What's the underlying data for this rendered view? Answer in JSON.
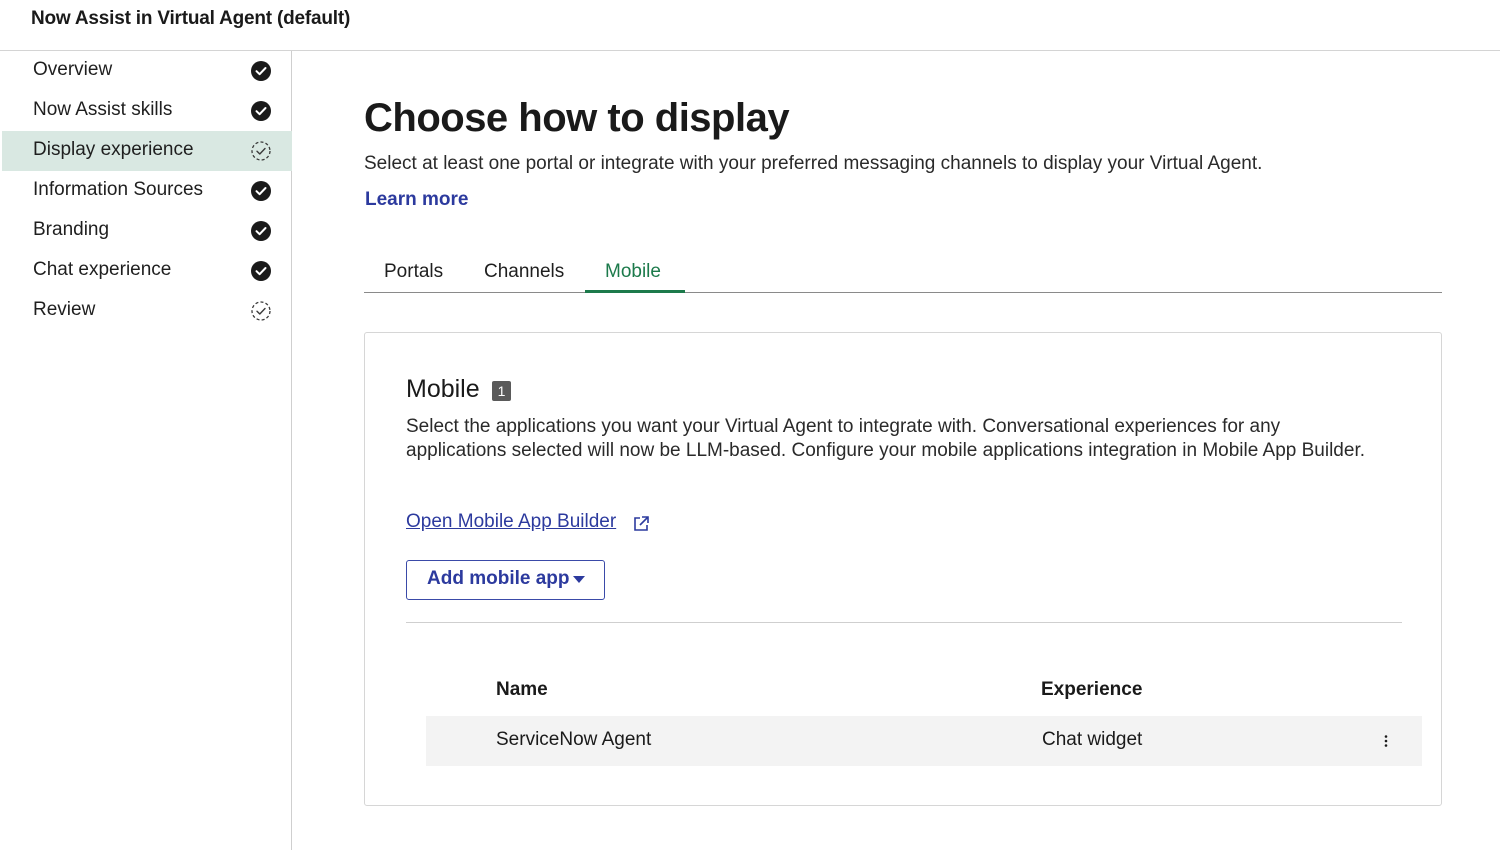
{
  "header": {
    "title": "Now Assist in Virtual Agent (default)"
  },
  "sidebar": {
    "items": [
      {
        "label": "Overview",
        "status": "complete"
      },
      {
        "label": "Now Assist skills",
        "status": "complete"
      },
      {
        "label": "Display experience",
        "status": "in-progress",
        "active": true
      },
      {
        "label": "Information Sources",
        "status": "complete"
      },
      {
        "label": "Branding",
        "status": "complete"
      },
      {
        "label": "Chat experience",
        "status": "complete"
      },
      {
        "label": "Review",
        "status": "in-progress"
      }
    ]
  },
  "main": {
    "title": "Choose how to display",
    "description": "Select at least one portal or integrate with your preferred messaging channels to display your Virtual Agent.",
    "learn_more": "Learn more",
    "tabs": [
      {
        "label": "Portals"
      },
      {
        "label": "Channels"
      },
      {
        "label": "Mobile",
        "active": true
      }
    ]
  },
  "mobile_card": {
    "title": "Mobile",
    "count": "1",
    "description": "Select the applications you want your Virtual Agent to integrate with. Conversational experiences for any applications selected will now be LLM-based. Configure your mobile applications integration in Mobile App Builder.",
    "builder_link": "Open Mobile App Builder",
    "add_button": "Add mobile app",
    "table": {
      "headers": {
        "name": "Name",
        "experience": "Experience"
      },
      "rows": [
        {
          "name": "ServiceNow Agent",
          "experience": "Chat widget"
        }
      ]
    }
  },
  "colors": {
    "accent_green": "#1c7a4b",
    "link_blue": "#2c3a9e",
    "active_nav_bg": "#d9e8e2"
  },
  "icons": {
    "complete": "check-circle-icon",
    "in_progress": "dashed-check-circle-icon"
  }
}
